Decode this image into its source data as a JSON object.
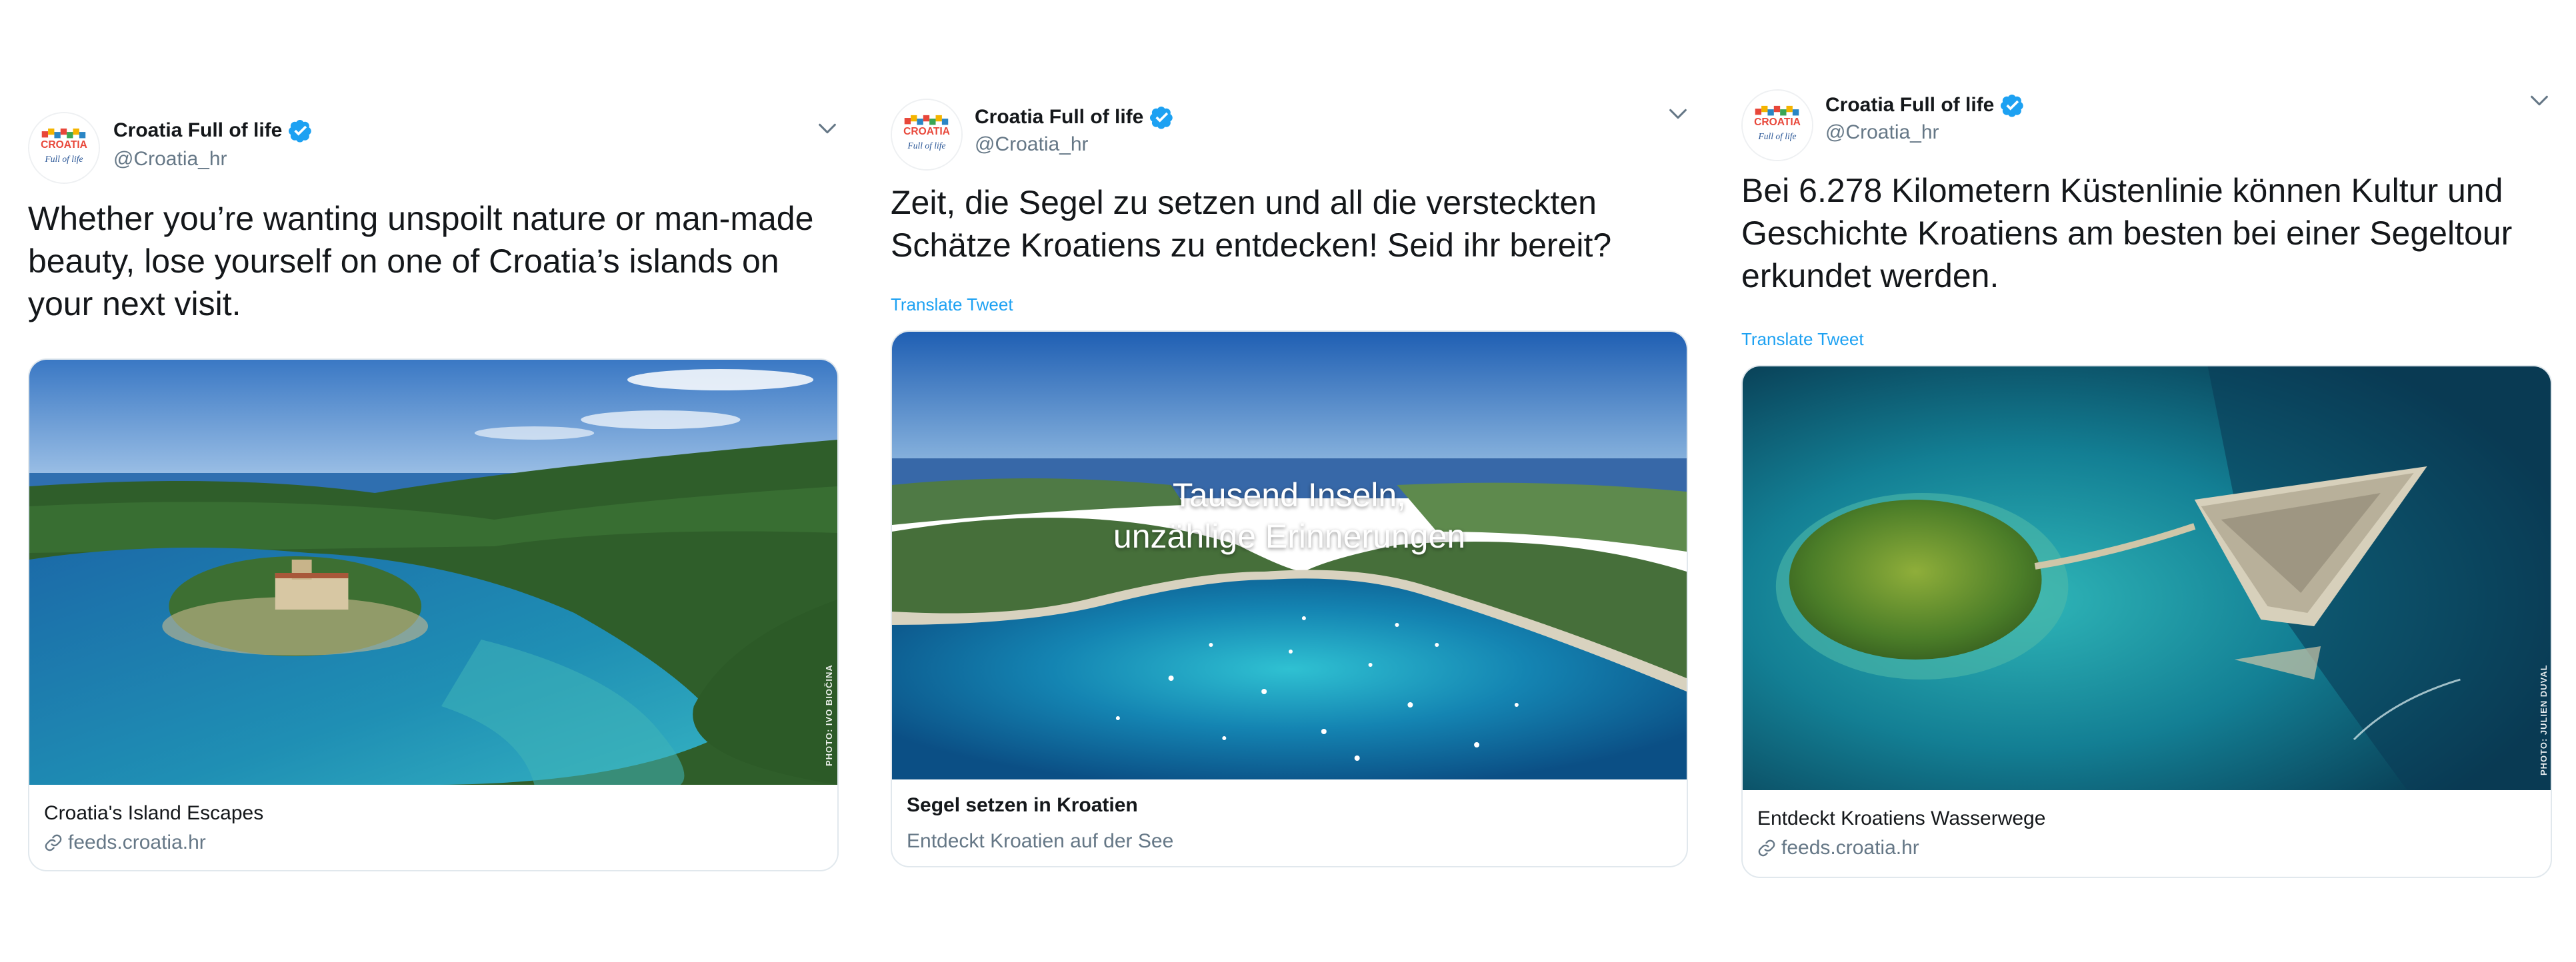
{
  "tweets": [
    {
      "account_name": "Croatia Full of life",
      "handle": "@Croatia_hr",
      "text": "Whether you’re wanting unspoilt nature or man-made beauty, lose yourself on one of Croatia’s islands on your next visit.",
      "card": {
        "image": "aerial photo of a lake island with a monastery surrounded by forested hills",
        "photo_credit": "PHOTO: IVO BIOČINA",
        "title": "Croatia's Island Escapes",
        "domain": "feeds.croatia.hr"
      }
    },
    {
      "account_name": "Croatia Full of life",
      "handle": "@Croatia_hr",
      "text": "Zeit, die Segel zu setzen und all die versteckten Schätze Kroatiens zu entdecken! Seid ihr bereit?",
      "translate_label": "Translate Tweet",
      "card": {
        "image": "aerial photo of a bay with white beach and anchored sailboats",
        "overlay_line1": "Tausend Inseln,",
        "overlay_line2": "unzählige Erinnerungen",
        "title": "Segel setzen in Kroatien",
        "description": "Entdeckt Kroatien auf der See"
      }
    },
    {
      "account_name": "Croatia Full of life",
      "handle": "@Croatia_hr",
      "text": "Bei 6.278 Kilometern Küstenlinie können Kultur und Geschichte Kroatiens am besten bei einer Segeltour erkundet werden.",
      "translate_label": "Translate Tweet",
      "card": {
        "image": "aerial photo of a forested islet next to a triangular fortress on a peninsula",
        "photo_credit": "PHOTO: JULIEN DUVAL",
        "title": "Entdeckt Kroatiens Wasserwege",
        "domain": "feeds.croatia.hr"
      }
    }
  ],
  "colors": {
    "text": "#14171a",
    "secondary": "#657786",
    "link": "#1da1f2",
    "verified": "#1da1f2",
    "border": "#e1e8ed"
  },
  "icons": [
    "croatia-logo-avatar-icon",
    "verified-badge-icon",
    "chevron-down-icon",
    "link-icon"
  ]
}
